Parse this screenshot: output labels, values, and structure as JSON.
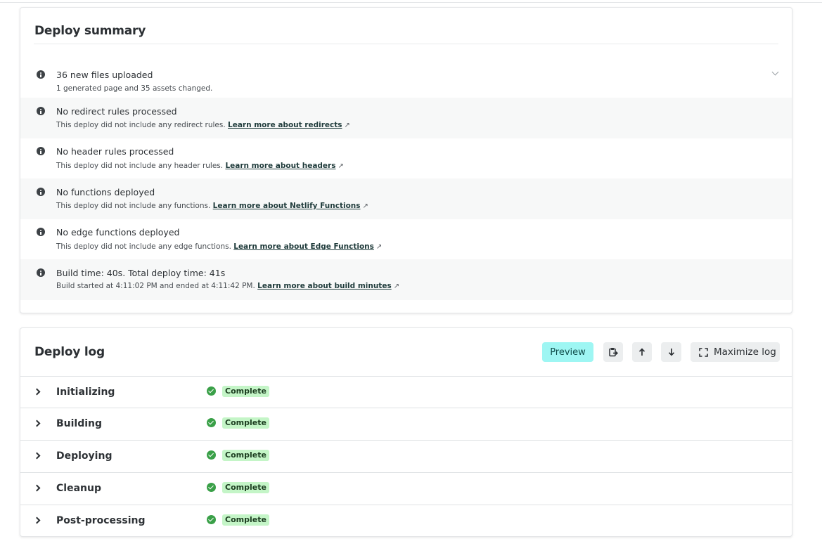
{
  "summary": {
    "title": "Deploy summary",
    "items": [
      {
        "title": "36 new files uploaded",
        "sub": "1 generated page and 35 assets changed.",
        "link": "",
        "expandable": true,
        "icon": "info-icon"
      },
      {
        "title": "No redirect rules processed",
        "sub": "This deploy did not include any redirect rules.",
        "link": "Learn more about redirects",
        "icon": "info-icon"
      },
      {
        "title": "No header rules processed",
        "sub": "This deploy did not include any header rules.",
        "link": "Learn more about headers",
        "icon": "info-icon"
      },
      {
        "title": "No functions deployed",
        "sub": "This deploy did not include any functions.",
        "link": "Learn more about Netlify Functions",
        "icon": "info-icon"
      },
      {
        "title": "No edge functions deployed",
        "sub": "This deploy did not include any edge functions.",
        "link": "Learn more about Edge Functions",
        "icon": "info-icon"
      },
      {
        "title": "Build time: 40s. Total deploy time: 41s",
        "sub": "Build started at 4:11:02 PM and ended at 4:11:42 PM.",
        "link": "Learn more about build minutes",
        "icon": "info-icon"
      }
    ],
    "external_arrow": "↗"
  },
  "log": {
    "title": "Deploy log",
    "preview_label": "Preview",
    "maximize_label": "Maximize log",
    "steps": [
      {
        "label": "Initializing",
        "status": "Complete"
      },
      {
        "label": "Building",
        "status": "Complete"
      },
      {
        "label": "Deploying",
        "status": "Complete"
      },
      {
        "label": "Cleanup",
        "status": "Complete"
      },
      {
        "label": "Post-processing",
        "status": "Complete"
      }
    ]
  },
  "colors": {
    "preview_bg": "#9ef6f3",
    "complete_bg": "#c4f5c7",
    "check_green": "#3aa048"
  }
}
